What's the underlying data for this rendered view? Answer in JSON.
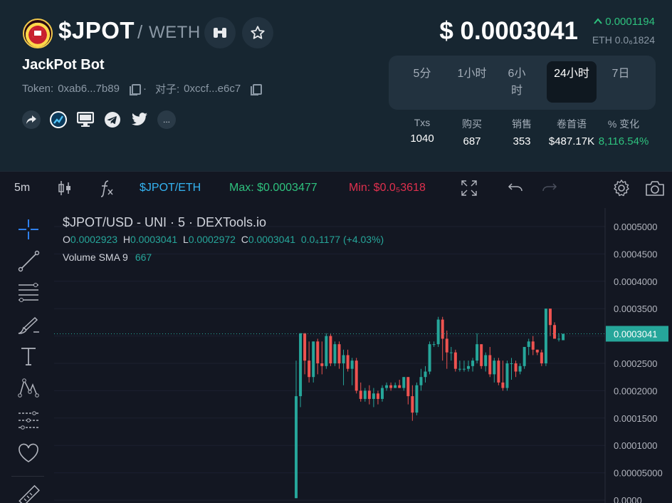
{
  "token": {
    "symbol": "$JPOT",
    "slash": "/",
    "quote": "WETH",
    "name": "JackPot Bot",
    "token_label": "Token:",
    "token_address": "0xab6...7b89",
    "pair_label": "对子:",
    "pair_address": "0xccf...e6c7",
    "address_separator": "·",
    "more_label": "..."
  },
  "price": {
    "usd": "$ 0.0003041",
    "change": "0.0001194",
    "eth": "ETH 0.0₆1824",
    "up_color": "#2ec27e"
  },
  "timeframes": [
    {
      "label": "5分",
      "active": false
    },
    {
      "label": "1小时",
      "active": false
    },
    {
      "label": "6小时",
      "active": false
    },
    {
      "label": "24小时",
      "active": true
    },
    {
      "label": "7日",
      "active": false
    }
  ],
  "stats": [
    {
      "label": "Txs",
      "value": "1040"
    },
    {
      "label": "购买",
      "value": "687"
    },
    {
      "label": "销售",
      "value": "353"
    },
    {
      "label": "卷首语",
      "value": "$487.17K"
    },
    {
      "label": "% 变化",
      "value": "8,116.54%"
    }
  ],
  "toolbar": {
    "interval": "5m",
    "pair": "$JPOT/ETH",
    "max": "Max: $0.0003477",
    "min": "Min: $0.0₅3618",
    "max_color": "#2ec27e",
    "min_color": "#e0304e",
    "pair_color": "#34b3f1"
  },
  "legend": {
    "title": "$JPOT/USD - UNI · 5 · DEXTools.io",
    "o_label": "O",
    "o": "0.0002923",
    "h_label": "H",
    "h": "0.0003041",
    "l_label": "L",
    "l": "0.0002972",
    "c_label": "C",
    "c": "0.0003041",
    "change": "0.0₄1177 (+4.03%)",
    "volume_label": "Volume SMA 9",
    "volume_value": "667"
  },
  "icons": {
    "header": [
      "binoculars-icon",
      "star-icon"
    ],
    "social": [
      "share-icon",
      "dextools-icon",
      "website-icon",
      "telegram-icon",
      "twitter-icon"
    ],
    "toolbar": [
      "candles-icon",
      "function-icon",
      "fullscreen-icon",
      "undo-icon",
      "redo-icon",
      "settings-icon",
      "camera-icon"
    ],
    "drawing": [
      "crosshair-icon",
      "trendline-icon",
      "fib-icon",
      "brush-icon",
      "text-icon",
      "pattern-icon",
      "prediction-icon",
      "heart-icon",
      "ruler-icon"
    ]
  },
  "chart_data": {
    "type": "candlestick",
    "ylim": [
      0,
      0.00055
    ],
    "y_ticks": [
      "0.0005000",
      "0.0004500",
      "0.0004000",
      "0.0003500",
      "0.0003000",
      "0.0002500",
      "0.0002000",
      "0.0001500",
      "0.0001000",
      "0.00005000",
      "0.0000"
    ],
    "y_tick_values": [
      0.0005,
      0.00045,
      0.0004,
      0.00035,
      0.0003,
      0.00025,
      0.0002,
      0.00015,
      0.0001,
      5e-05,
      0
    ],
    "last_price": "0.0003041",
    "last_price_value": 0.0003041,
    "up_color": "#26a69a",
    "down_color": "#ef5350",
    "candles": [
      {
        "o": 3.6e-06,
        "h": 0.000255,
        "l": 3.6e-06,
        "c": 0.00019
      },
      {
        "o": 0.00019,
        "h": 0.000305,
        "l": 0.00017,
        "c": 0.000305
      },
      {
        "o": 0.000305,
        "h": 0.000305,
        "l": 0.00023,
        "c": 0.000255
      },
      {
        "o": 0.000255,
        "h": 0.00029,
        "l": 0.000215,
        "c": 0.000225
      },
      {
        "o": 0.000225,
        "h": 0.00029,
        "l": 0.000215,
        "c": 0.00029
      },
      {
        "o": 0.00029,
        "h": 0.000295,
        "l": 0.00023,
        "c": 0.00025
      },
      {
        "o": 0.00025,
        "h": 0.00029,
        "l": 0.00023,
        "c": 0.000245
      },
      {
        "o": 0.000245,
        "h": 0.000305,
        "l": 0.00024,
        "c": 0.0003
      },
      {
        "o": 0.0003,
        "h": 0.000305,
        "l": 0.000245,
        "c": 0.00025
      },
      {
        "o": 0.00025,
        "h": 0.00029,
        "l": 0.000245,
        "c": 0.000285
      },
      {
        "o": 0.000285,
        "h": 0.00029,
        "l": 0.00024,
        "c": 0.00025
      },
      {
        "o": 0.00025,
        "h": 0.000275,
        "l": 0.00021,
        "c": 0.000265
      },
      {
        "o": 0.000265,
        "h": 0.000275,
        "l": 0.000235,
        "c": 0.00024
      },
      {
        "o": 0.00024,
        "h": 0.00026,
        "l": 0.00021,
        "c": 0.000255
      },
      {
        "o": 0.000255,
        "h": 0.00026,
        "l": 0.000195,
        "c": 0.0002
      },
      {
        "o": 0.0002,
        "h": 0.000215,
        "l": 0.00018,
        "c": 0.000185
      },
      {
        "o": 0.000185,
        "h": 0.000205,
        "l": 0.00018,
        "c": 0.0002
      },
      {
        "o": 0.0002,
        "h": 0.00021,
        "l": 0.000175,
        "c": 0.000185
      },
      {
        "o": 0.000185,
        "h": 0.000205,
        "l": 0.00017,
        "c": 0.000195
      },
      {
        "o": 0.000195,
        "h": 0.0002,
        "l": 0.000175,
        "c": 0.000185
      },
      {
        "o": 0.000185,
        "h": 0.00021,
        "l": 0.00018,
        "c": 0.000205
      },
      {
        "o": 0.000205,
        "h": 0.000215,
        "l": 0.0002,
        "c": 0.00021
      },
      {
        "o": 0.00021,
        "h": 0.000215,
        "l": 0.0002,
        "c": 0.000205
      },
      {
        "o": 0.000205,
        "h": 0.000215,
        "l": 0.000205,
        "c": 0.00021
      },
      {
        "o": 0.00021,
        "h": 0.00022,
        "l": 0.000205,
        "c": 0.000205
      },
      {
        "o": 0.000205,
        "h": 0.000225,
        "l": 0.0002,
        "c": 0.000225
      },
      {
        "o": 0.000225,
        "h": 0.000225,
        "l": 0.000175,
        "c": 0.00019
      },
      {
        "o": 0.00019,
        "h": 0.00021,
        "l": 0.000145,
        "c": 0.00016
      },
      {
        "o": 0.00016,
        "h": 0.000215,
        "l": 0.000155,
        "c": 0.00021
      },
      {
        "o": 0.00021,
        "h": 0.00024,
        "l": 0.0002,
        "c": 0.000225
      },
      {
        "o": 0.000225,
        "h": 0.000245,
        "l": 0.000215,
        "c": 0.000235
      },
      {
        "o": 0.000235,
        "h": 0.00029,
        "l": 0.00023,
        "c": 0.000285
      },
      {
        "o": 0.000285,
        "h": 0.00029,
        "l": 0.00028,
        "c": 0.000285
      },
      {
        "o": 0.000285,
        "h": 0.000335,
        "l": 0.00028,
        "c": 0.00033
      },
      {
        "o": 0.00033,
        "h": 0.000335,
        "l": 0.000255,
        "c": 0.000295
      },
      {
        "o": 0.000295,
        "h": 0.00031,
        "l": 0.00024,
        "c": 0.00027
      },
      {
        "o": 0.00027,
        "h": 0.00028,
        "l": 0.000255,
        "c": 0.00027
      },
      {
        "o": 0.00027,
        "h": 0.000275,
        "l": 0.000235,
        "c": 0.00024
      },
      {
        "o": 0.00024,
        "h": 0.000255,
        "l": 0.000235,
        "c": 0.00024
      },
      {
        "o": 0.00024,
        "h": 0.000255,
        "l": 0.000235,
        "c": 0.00024
      },
      {
        "o": 0.00024,
        "h": 0.000255,
        "l": 0.000235,
        "c": 0.000245
      },
      {
        "o": 0.000245,
        "h": 0.00026,
        "l": 0.000235,
        "c": 0.000255
      },
      {
        "o": 0.000255,
        "h": 0.000305,
        "l": 0.00025,
        "c": 0.000285
      },
      {
        "o": 0.000285,
        "h": 0.000285,
        "l": 0.00024,
        "c": 0.000245
      },
      {
        "o": 0.000245,
        "h": 0.00027,
        "l": 0.000235,
        "c": 0.000265
      },
      {
        "o": 0.000265,
        "h": 0.00028,
        "l": 0.000225,
        "c": 0.00023
      },
      {
        "o": 0.00023,
        "h": 0.00026,
        "l": 0.000215,
        "c": 0.000255
      },
      {
        "o": 0.000255,
        "h": 0.00026,
        "l": 0.00021,
        "c": 0.000215
      },
      {
        "o": 0.000215,
        "h": 0.000255,
        "l": 0.0002,
        "c": 0.000205
      },
      {
        "o": 0.000205,
        "h": 0.000255,
        "l": 0.0002,
        "c": 0.00025
      },
      {
        "o": 0.00025,
        "h": 0.00026,
        "l": 0.00022,
        "c": 0.00025
      },
      {
        "o": 0.00025,
        "h": 0.000255,
        "l": 0.000225,
        "c": 0.000235
      },
      {
        "o": 0.000235,
        "h": 0.00025,
        "l": 0.00023,
        "c": 0.000245
      },
      {
        "o": 0.000245,
        "h": 0.00028,
        "l": 0.00024,
        "c": 0.00028
      },
      {
        "o": 0.00028,
        "h": 0.000295,
        "l": 0.000265,
        "c": 0.00029
      },
      {
        "o": 0.00029,
        "h": 0.0003,
        "l": 0.000265,
        "c": 0.000275
      },
      {
        "o": 0.000275,
        "h": 0.000275,
        "l": 0.000265,
        "c": 0.00027
      },
      {
        "o": 0.00027,
        "h": 0.000275,
        "l": 0.000245,
        "c": 0.00025
      },
      {
        "o": 0.00025,
        "h": 0.00035,
        "l": 0.000245,
        "c": 0.00035
      },
      {
        "o": 0.00035,
        "h": 0.00035,
        "l": 0.0003,
        "c": 0.00032
      },
      {
        "o": 0.00032,
        "h": 0.000325,
        "l": 0.0003,
        "c": 0.000295
      },
      {
        "o": 0.000295,
        "h": 0.000305,
        "l": 0.00029,
        "c": 0.000295
      },
      {
        "o": 0.0002923,
        "h": 0.0003041,
        "l": 0.0002972,
        "c": 0.0003041
      }
    ]
  }
}
